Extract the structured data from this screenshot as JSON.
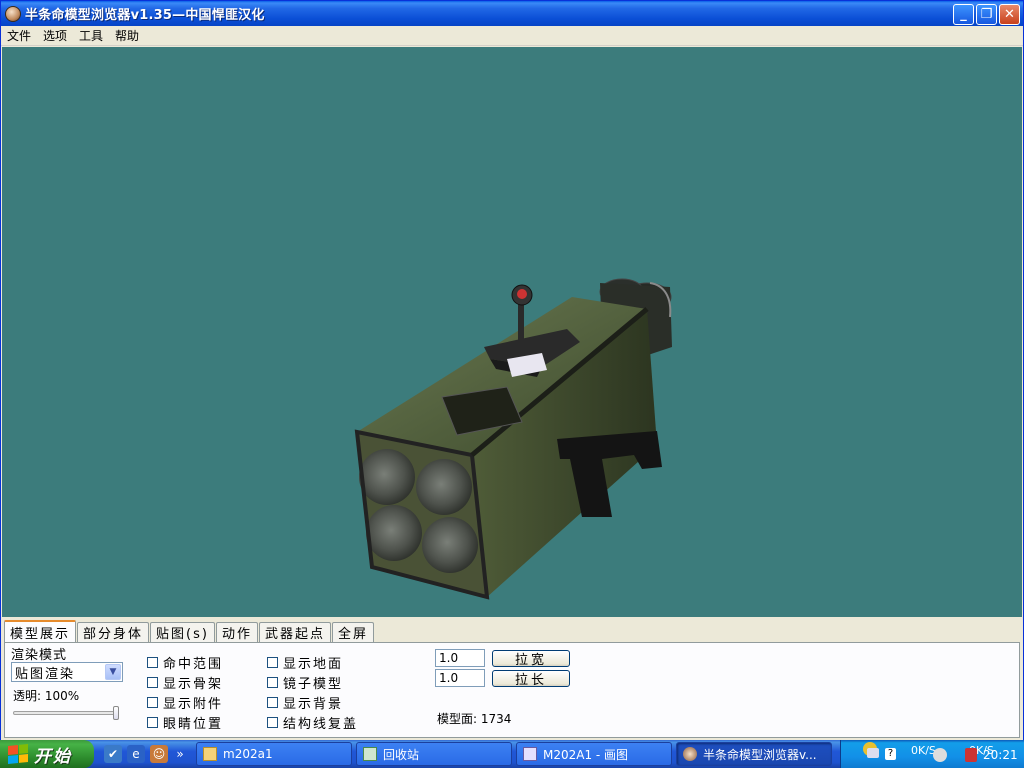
{
  "window": {
    "title": "半条命模型浏览器v1.35—中国悍匪汉化",
    "minimize_label": "_",
    "restore_label": "❐",
    "close_label": "✕"
  },
  "menu": [
    "文件",
    "选项",
    "工具",
    "帮助"
  ],
  "tabs": [
    "模型展示",
    "部分身体",
    "贴图(s)",
    "动作",
    "武器起点",
    "全屏"
  ],
  "model_panel": {
    "render_mode_label": "渲染模式",
    "render_mode_value": "贴图渲染",
    "opacity_label": "透明: 100%",
    "opacity": 1.0,
    "checkboxes_col1": [
      "命中范围",
      "显示骨架",
      "显示附件",
      "眼睛位置"
    ],
    "checkboxes_col2": [
      "显示地面",
      "镜子模型",
      "显示背景",
      "结构线复盖"
    ],
    "stretch_width_value": "1.0",
    "stretch_width_label": "拉宽",
    "stretch_length_value": "1.0",
    "stretch_length_label": "拉长",
    "model_faces_label": "模型面: 1734"
  },
  "colors": {
    "viewport_bg": "#3c7c7c",
    "titlebar": "#0b4fd6",
    "taskbar": "#2157d7"
  },
  "taskbar": {
    "start_label": "开始",
    "tasks": [
      {
        "label": "m202a1",
        "icon": "folder-icon"
      },
      {
        "label": "回收站",
        "icon": "recycle-bin-icon"
      },
      {
        "label": "M202A1 - 画图",
        "icon": "paint-icon"
      },
      {
        "label": "半条命模型浏览器v...",
        "icon": "hlmv-icon"
      }
    ],
    "net_down": "0K/S",
    "net_up": "0K/S",
    "clock": "20:21"
  }
}
